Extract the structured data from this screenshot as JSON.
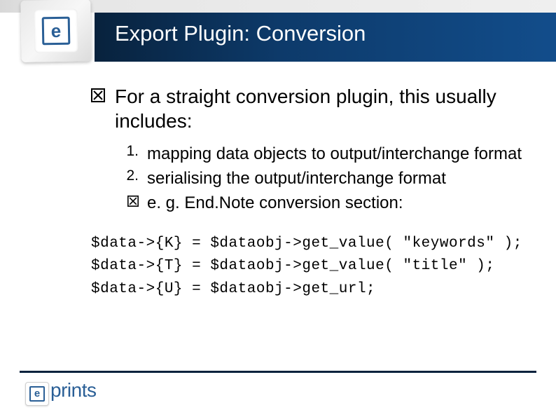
{
  "header": {
    "title": "Export Plugin: Conversion",
    "logo_letter": "e"
  },
  "content": {
    "main_bullet": "For a straight conversion plugin, this usually includes:",
    "sub_items": [
      {
        "marker": "1.",
        "text": "mapping data objects to output/interchange format"
      },
      {
        "marker": "2.",
        "text": "serialising the output/interchange format"
      },
      {
        "marker": "x",
        "text": "e. g. End.Note conversion section:"
      }
    ],
    "code": "$data->{K} = $dataobj->get_value( \"keywords\" );\n$data->{T} = $dataobj->get_value( \"title\" );\n$data->{U} = $dataobj->get_url;"
  },
  "footer": {
    "logo_letter": "e",
    "brand_text": "prints"
  }
}
